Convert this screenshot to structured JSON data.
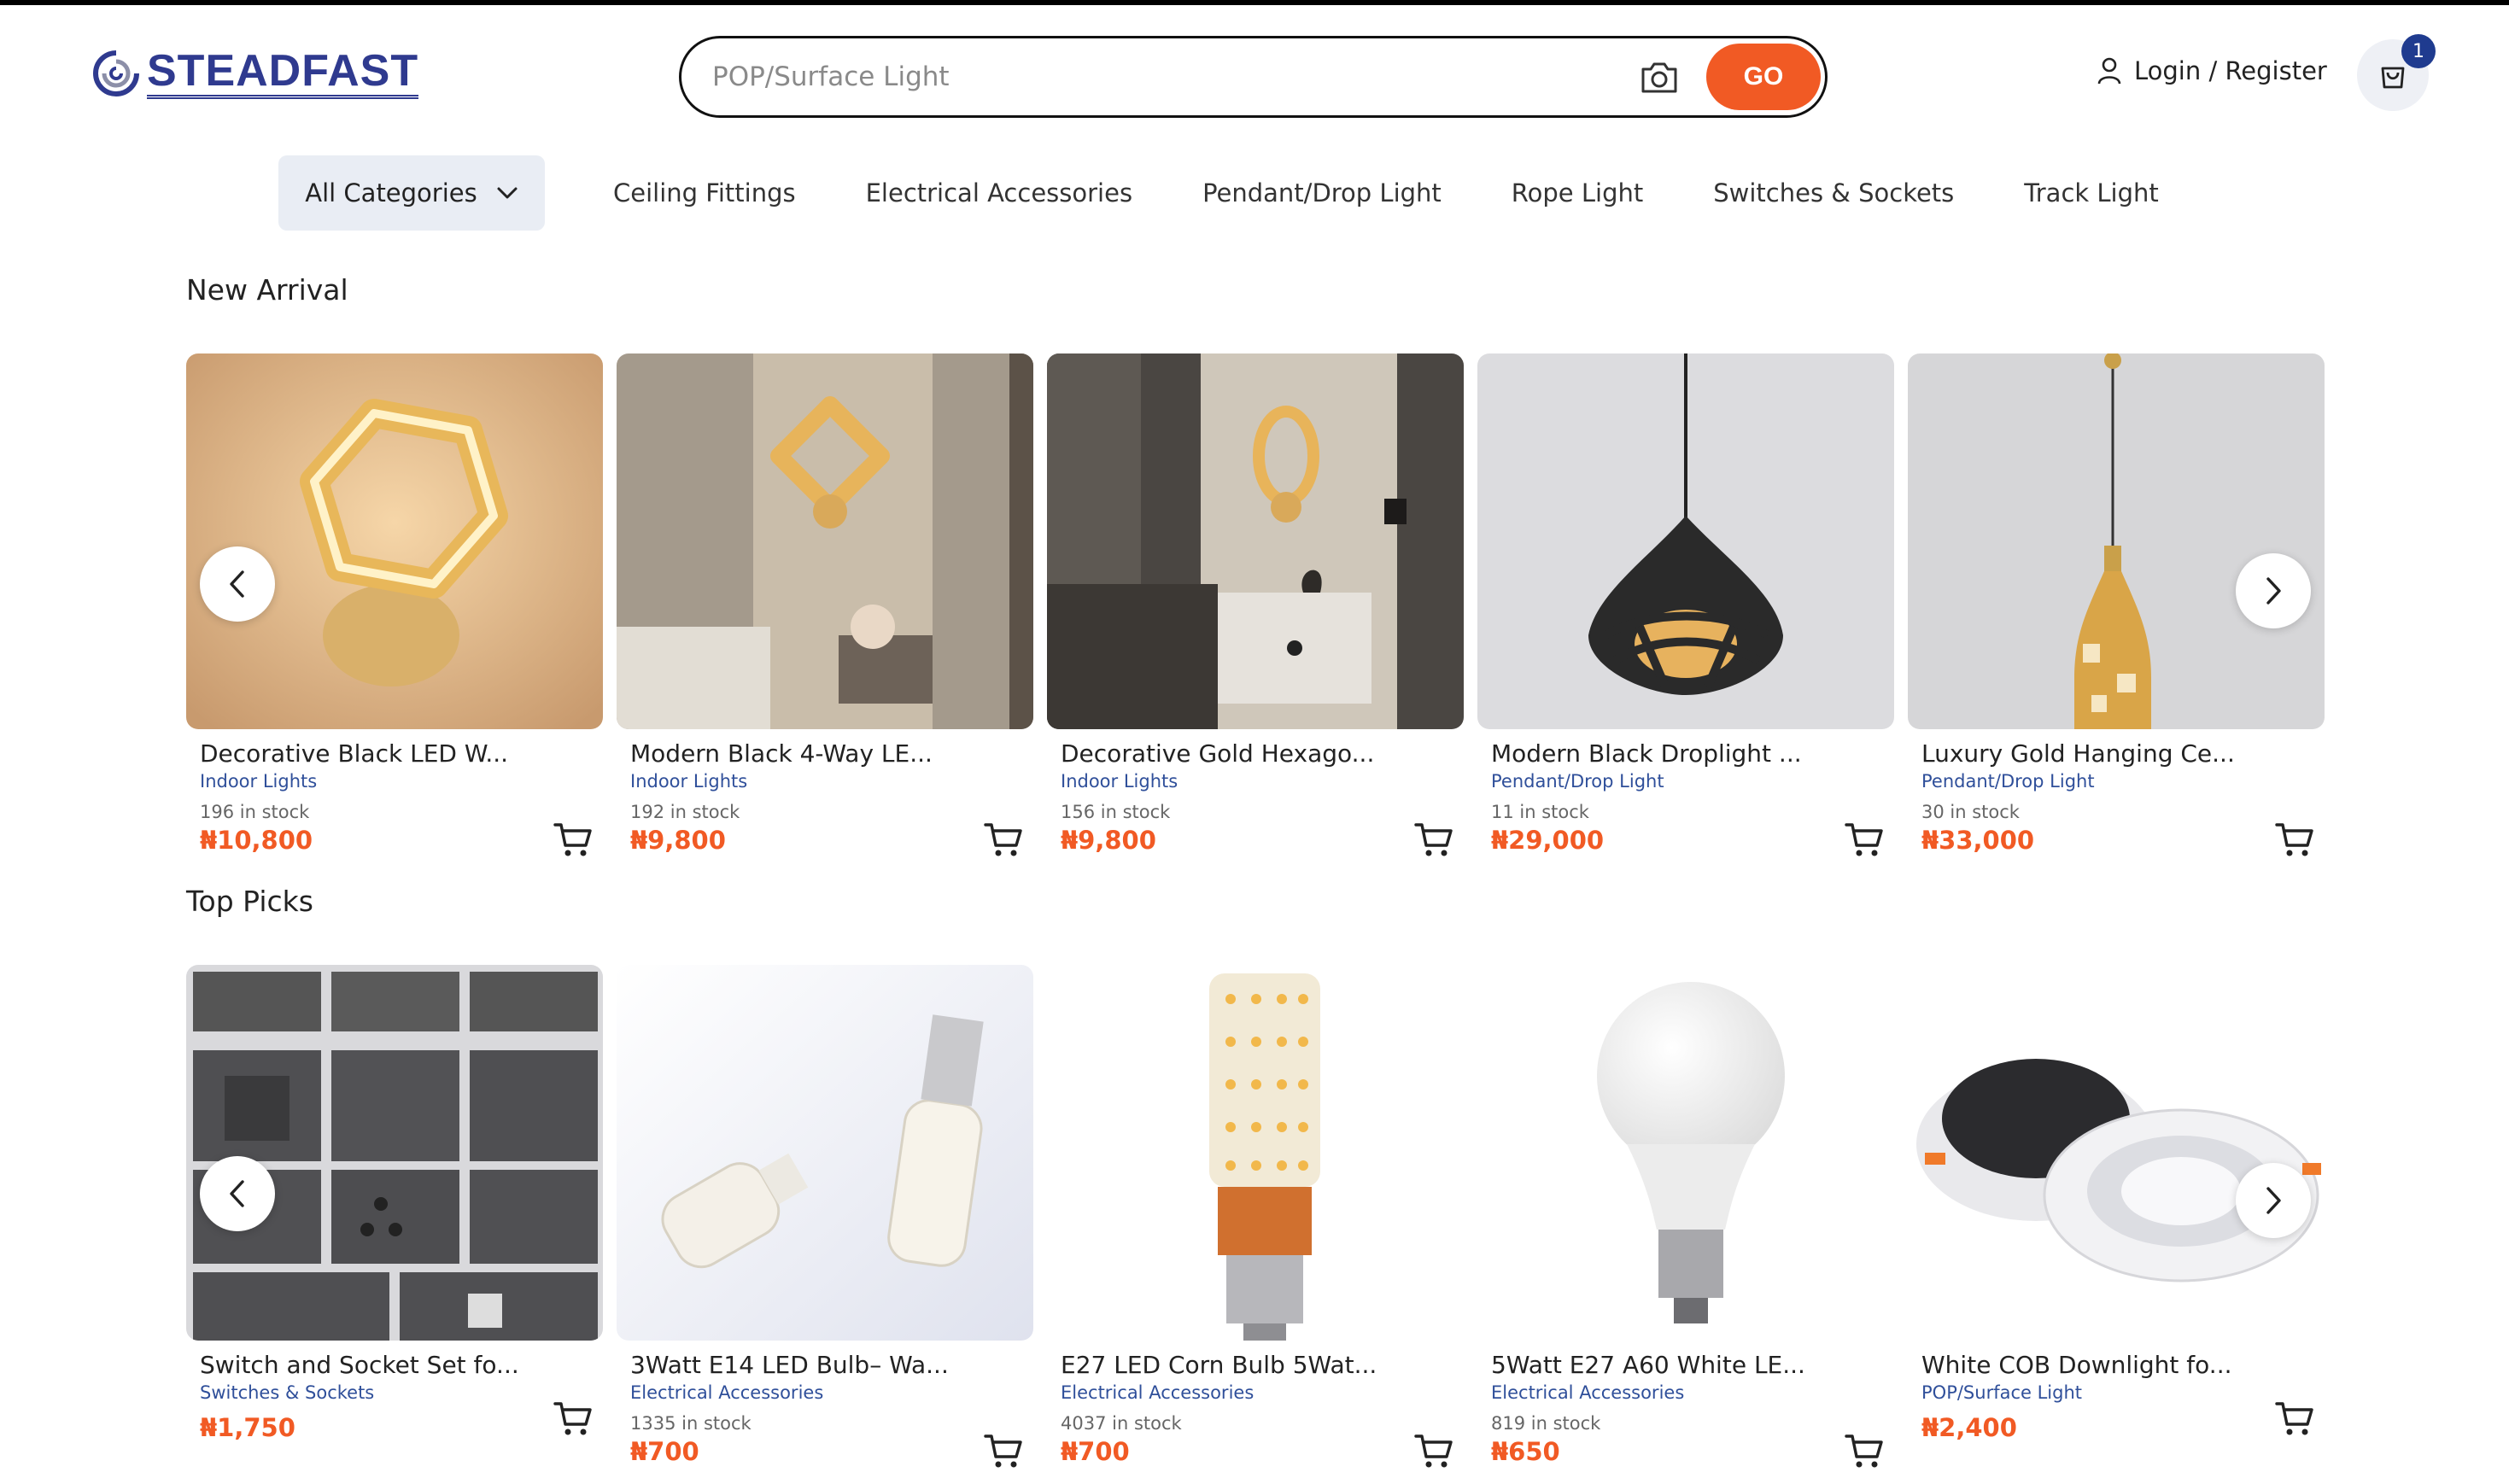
{
  "brand": {
    "name": "STEADFAST"
  },
  "search": {
    "placeholder": "POP/Surface Light",
    "go_label": "GO"
  },
  "account": {
    "login_label": "Login / Register",
    "cart_count": "1"
  },
  "categories": {
    "all_label": "All Categories",
    "items": [
      "Ceiling Fittings",
      "Electrical Accessories",
      "Pendant/Drop Light",
      "Rope Light",
      "Switches & Sockets",
      "Track Light"
    ]
  },
  "new_arrival": {
    "title": "New Arrival",
    "products": [
      {
        "name": "Decorative Black LED W...",
        "category": "Indoor Lights",
        "stock": "196 in stock",
        "price": "₦10,800"
      },
      {
        "name": "Modern Black 4-Way LE...",
        "category": "Indoor Lights",
        "stock": "192 in stock",
        "price": "₦9,800"
      },
      {
        "name": "Decorative Gold Hexago...",
        "category": "Indoor Lights",
        "stock": "156 in stock",
        "price": "₦9,800"
      },
      {
        "name": "Modern Black Droplight ...",
        "category": "Pendant/Drop Light",
        "stock": "11 in stock",
        "price": "₦29,000"
      },
      {
        "name": "Luxury Gold Hanging Ce...",
        "category": "Pendant/Drop Light",
        "stock": "30 in stock",
        "price": "₦33,000"
      }
    ]
  },
  "top_picks": {
    "title": "Top Picks",
    "products": [
      {
        "name": "Switch and Socket Set fo...",
        "category": "Switches & Sockets",
        "stock": "",
        "price": "₦1,750"
      },
      {
        "name": "3Watt E14 LED Bulb– Wa...",
        "category": "Electrical Accessories",
        "stock": "1335 in stock",
        "price": "₦700"
      },
      {
        "name": "E27 LED Corn Bulb 5Wat...",
        "category": "Electrical Accessories",
        "stock": "4037 in stock",
        "price": "₦700"
      },
      {
        "name": "5Watt E27 A60 White LE...",
        "category": "Electrical Accessories",
        "stock": "819 in stock",
        "price": "₦650"
      },
      {
        "name": "White COB Downlight fo...",
        "category": "POP/Surface Light",
        "stock": "",
        "price": "₦2,400"
      }
    ]
  },
  "colors": {
    "accent": "#f15a24",
    "brand": "#2f3a8f",
    "link": "#2f4f9a"
  }
}
